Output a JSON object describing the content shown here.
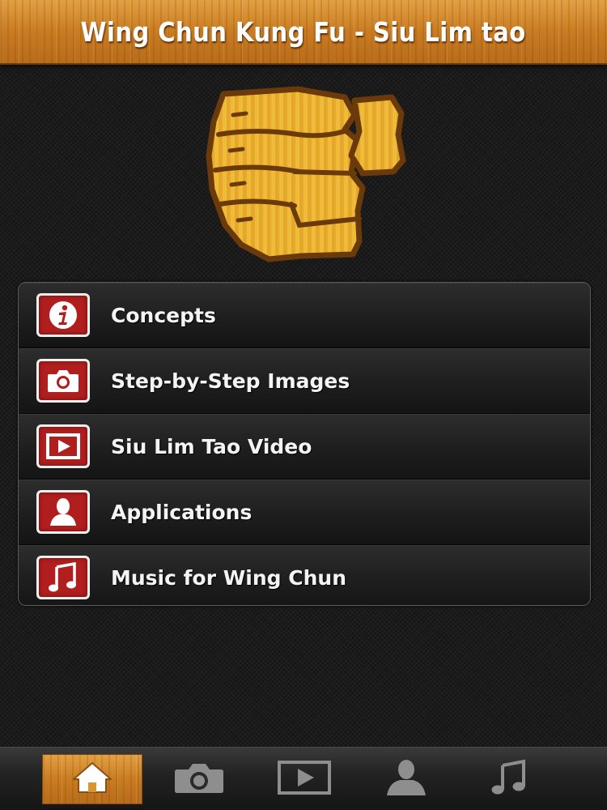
{
  "header": {
    "title": "Wing Chun Kung Fu - Siu Lim tao"
  },
  "logo": {
    "icon": "wooden-fist-icon"
  },
  "menu": {
    "items": [
      {
        "label": "Concepts",
        "icon": "info-icon"
      },
      {
        "label": "Step-by-Step Images",
        "icon": "camera-icon"
      },
      {
        "label": "Siu Lim Tao Video",
        "icon": "video-play-icon"
      },
      {
        "label": "Applications",
        "icon": "person-icon"
      },
      {
        "label": "Music for Wing Chun",
        "icon": "music-note-icon"
      }
    ]
  },
  "tabbar": {
    "tabs": [
      {
        "icon": "home-icon",
        "active": true
      },
      {
        "icon": "camera-icon",
        "active": false
      },
      {
        "icon": "video-play-icon",
        "active": false
      },
      {
        "icon": "person-icon",
        "active": false
      },
      {
        "icon": "music-note-icon",
        "active": false
      }
    ]
  },
  "colors": {
    "wood": "#d28a2a",
    "icon_red": "#b01e1e",
    "background": "#1b1b1b"
  }
}
